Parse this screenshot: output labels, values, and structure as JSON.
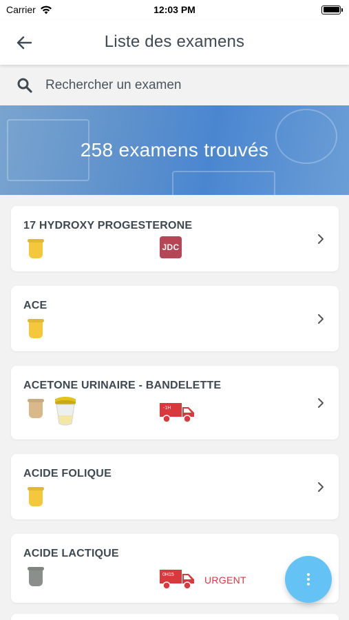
{
  "status_bar": {
    "carrier": "Carrier",
    "time": "12:03 PM"
  },
  "header": {
    "title": "Liste des examens"
  },
  "search": {
    "placeholder": "Rechercher un examen"
  },
  "banner": {
    "text": "258 examens trouvés"
  },
  "exams": [
    {
      "name": "17 HYDROXY PROGESTERONE",
      "tube": "yellow",
      "badge": "JDC"
    },
    {
      "name": "ACE",
      "tube": "yellow"
    },
    {
      "name": "ACETONE URINAIRE - BANDELETTE",
      "tube": "beige",
      "truck_label": "-1H"
    },
    {
      "name": "ACIDE FOLIQUE",
      "tube": "yellow"
    },
    {
      "name": "ACIDE LACTIQUE",
      "tube": "grey",
      "truck_label": "0H15",
      "urgent": "URGENT"
    }
  ],
  "colors": {
    "accent_fab": "#64c2f4",
    "badge_jdc": "#b64555",
    "truck": "#d8393d",
    "tube_yellow": "#f5c73b",
    "tube_beige": "#d9b98a",
    "tube_grey": "#8a8f8c"
  },
  "icons": [
    "back-arrow-icon",
    "search-icon",
    "chevron-right-icon",
    "tube-icon",
    "urine-cup-icon",
    "delivery-truck-icon",
    "more-vertical-icon",
    "wifi-icon",
    "battery-icon"
  ]
}
